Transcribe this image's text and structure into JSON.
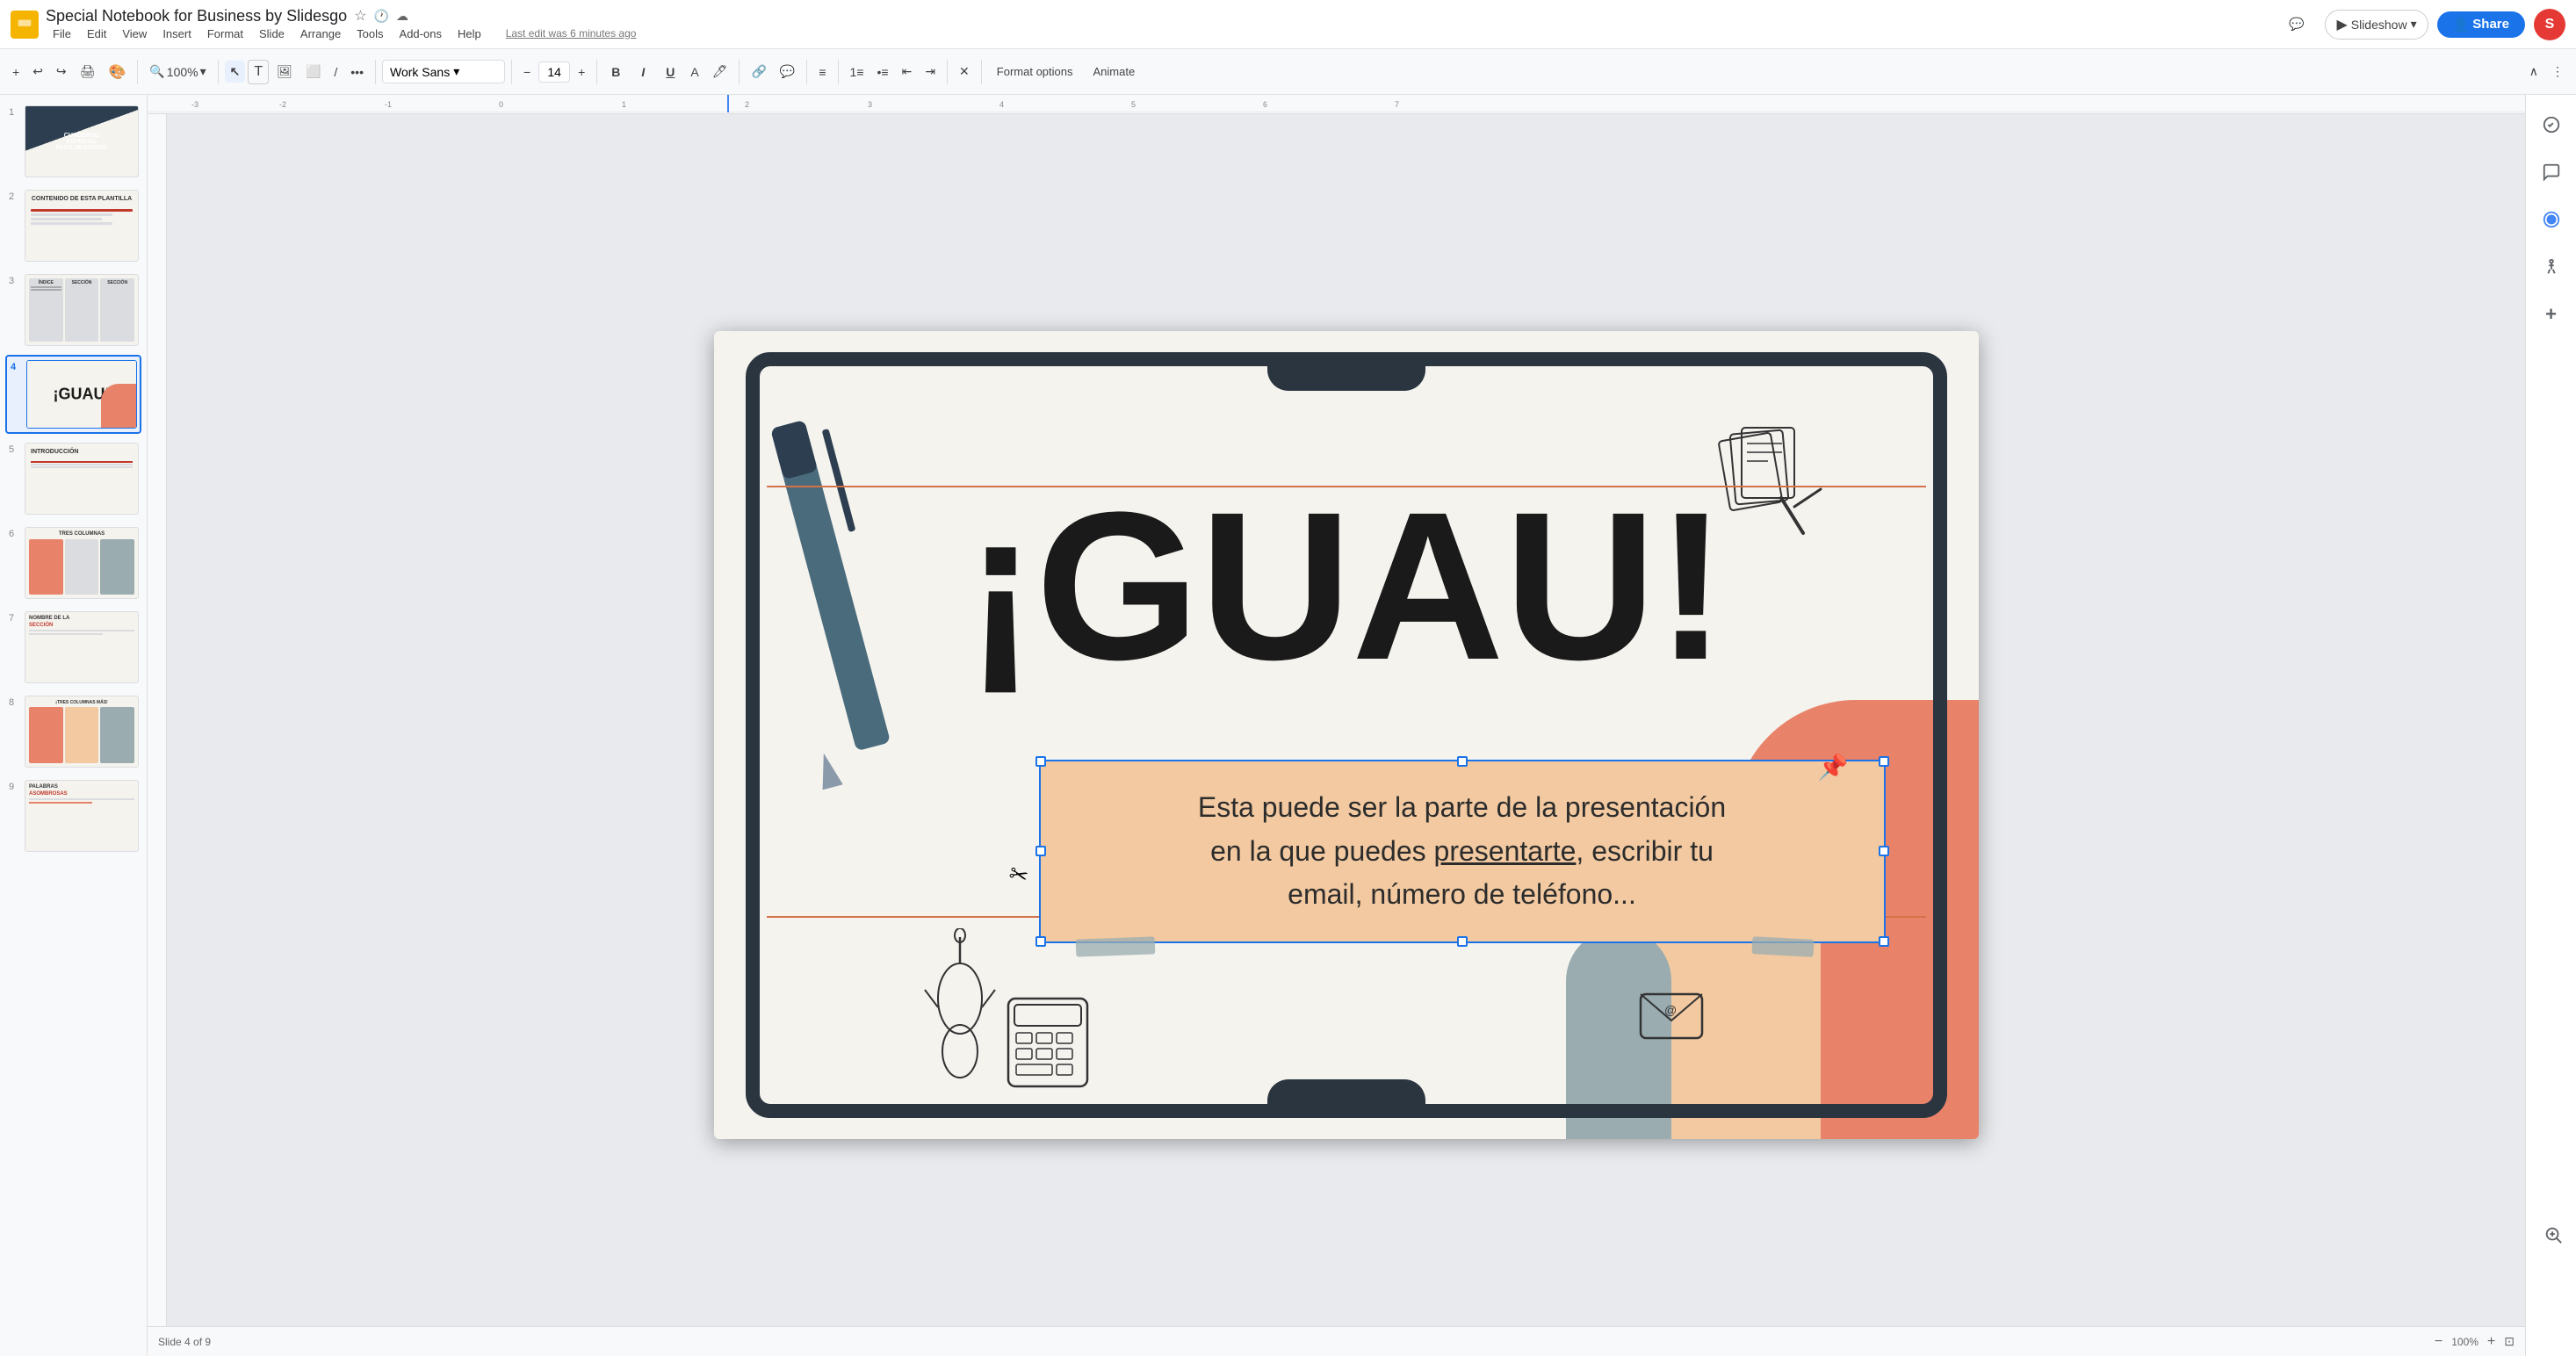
{
  "app": {
    "icon": "📊",
    "title": "Special Notebook for Business by Slidesgo",
    "last_edit": "Last edit was 6 minutes ago"
  },
  "menu": {
    "items": [
      "File",
      "Edit",
      "View",
      "Insert",
      "Format",
      "Slide",
      "Arrange",
      "Tools",
      "Add-ons",
      "Help"
    ]
  },
  "toolbar": {
    "zoom_label": "100%",
    "font_name": "Work Sans",
    "font_size": "14",
    "bold": "B",
    "italic": "I",
    "underline": "U",
    "format_options": "Format options",
    "animate": "Animate"
  },
  "slideshow_btn": "Slideshow",
  "share_btn": "Share",
  "avatar_initials": "S",
  "slides": [
    {
      "num": "1",
      "label": "CUADERNO ESPECIAL"
    },
    {
      "num": "2",
      "label": "CONTENIDO"
    },
    {
      "num": "3",
      "label": "ÍNDICE"
    },
    {
      "num": "4",
      "label": "¡GUAU!",
      "active": true
    },
    {
      "num": "5",
      "label": "INTRODUCCIÓN"
    },
    {
      "num": "6",
      "label": "TRES COLUMNAS"
    },
    {
      "num": "7",
      "label": "NOMBRE DE LA SECCIÓN"
    },
    {
      "num": "8",
      "label": "¡TRES COLUMNAS MÁS!"
    },
    {
      "num": "9",
      "label": "PALABRAS ASOMBROSAS"
    }
  ],
  "slide_main": {
    "guau_text": "¡GUAU!",
    "note_text_line1": "Esta puede ser la parte de la presentación",
    "note_text_line2": "en la que puedes ",
    "note_text_underline": "presentarte",
    "note_text_line3": ", escribir tu",
    "note_text_line4": "email, número de teléfono..."
  },
  "bottom": {
    "slide_current": "Slide 4 of 9",
    "zoom": "100%"
  }
}
